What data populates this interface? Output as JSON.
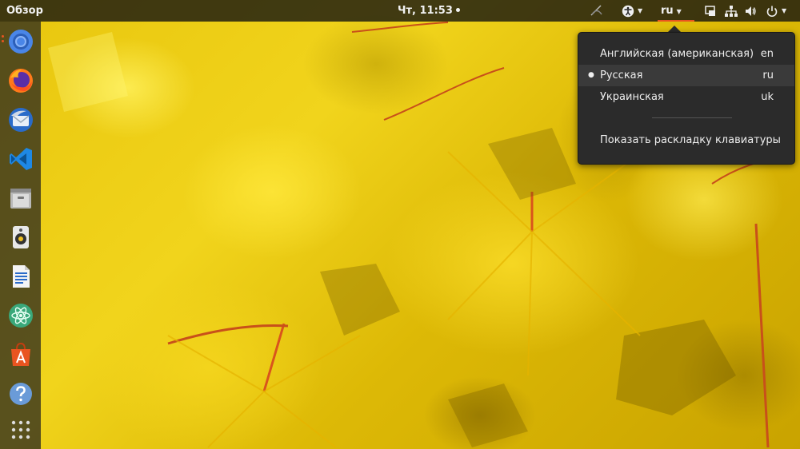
{
  "topbar": {
    "activities_label": "Обзор",
    "clock": "Чт, 11:53",
    "language_indicator": "ru"
  },
  "dock": {
    "items": [
      {
        "name": "chromium",
        "icon": "chromium-icon"
      },
      {
        "name": "firefox",
        "icon": "firefox-icon"
      },
      {
        "name": "thunderbird",
        "icon": "thunderbird-icon"
      },
      {
        "name": "vscode",
        "icon": "vscode-icon"
      },
      {
        "name": "files",
        "icon": "file-cabinet-icon"
      },
      {
        "name": "rhythmbox",
        "icon": "speaker-icon"
      },
      {
        "name": "libreoffice-writer",
        "icon": "writer-document-icon"
      },
      {
        "name": "atom",
        "icon": "atom-icon"
      },
      {
        "name": "software",
        "icon": "software-center-icon"
      },
      {
        "name": "help",
        "icon": "help-icon"
      },
      {
        "name": "show-apps",
        "icon": "app-grid-icon"
      }
    ]
  },
  "language_menu": {
    "items": [
      {
        "label": "Английская (американская)",
        "code": "en",
        "selected": false
      },
      {
        "label": "Русская",
        "code": "ru",
        "selected": true
      },
      {
        "label": "Украинская",
        "code": "uk",
        "selected": false
      }
    ],
    "show_layout_label": "Показать раскладку клавиатуры"
  },
  "colors": {
    "accent": "#e95420",
    "panel": "#2b2b2b"
  }
}
